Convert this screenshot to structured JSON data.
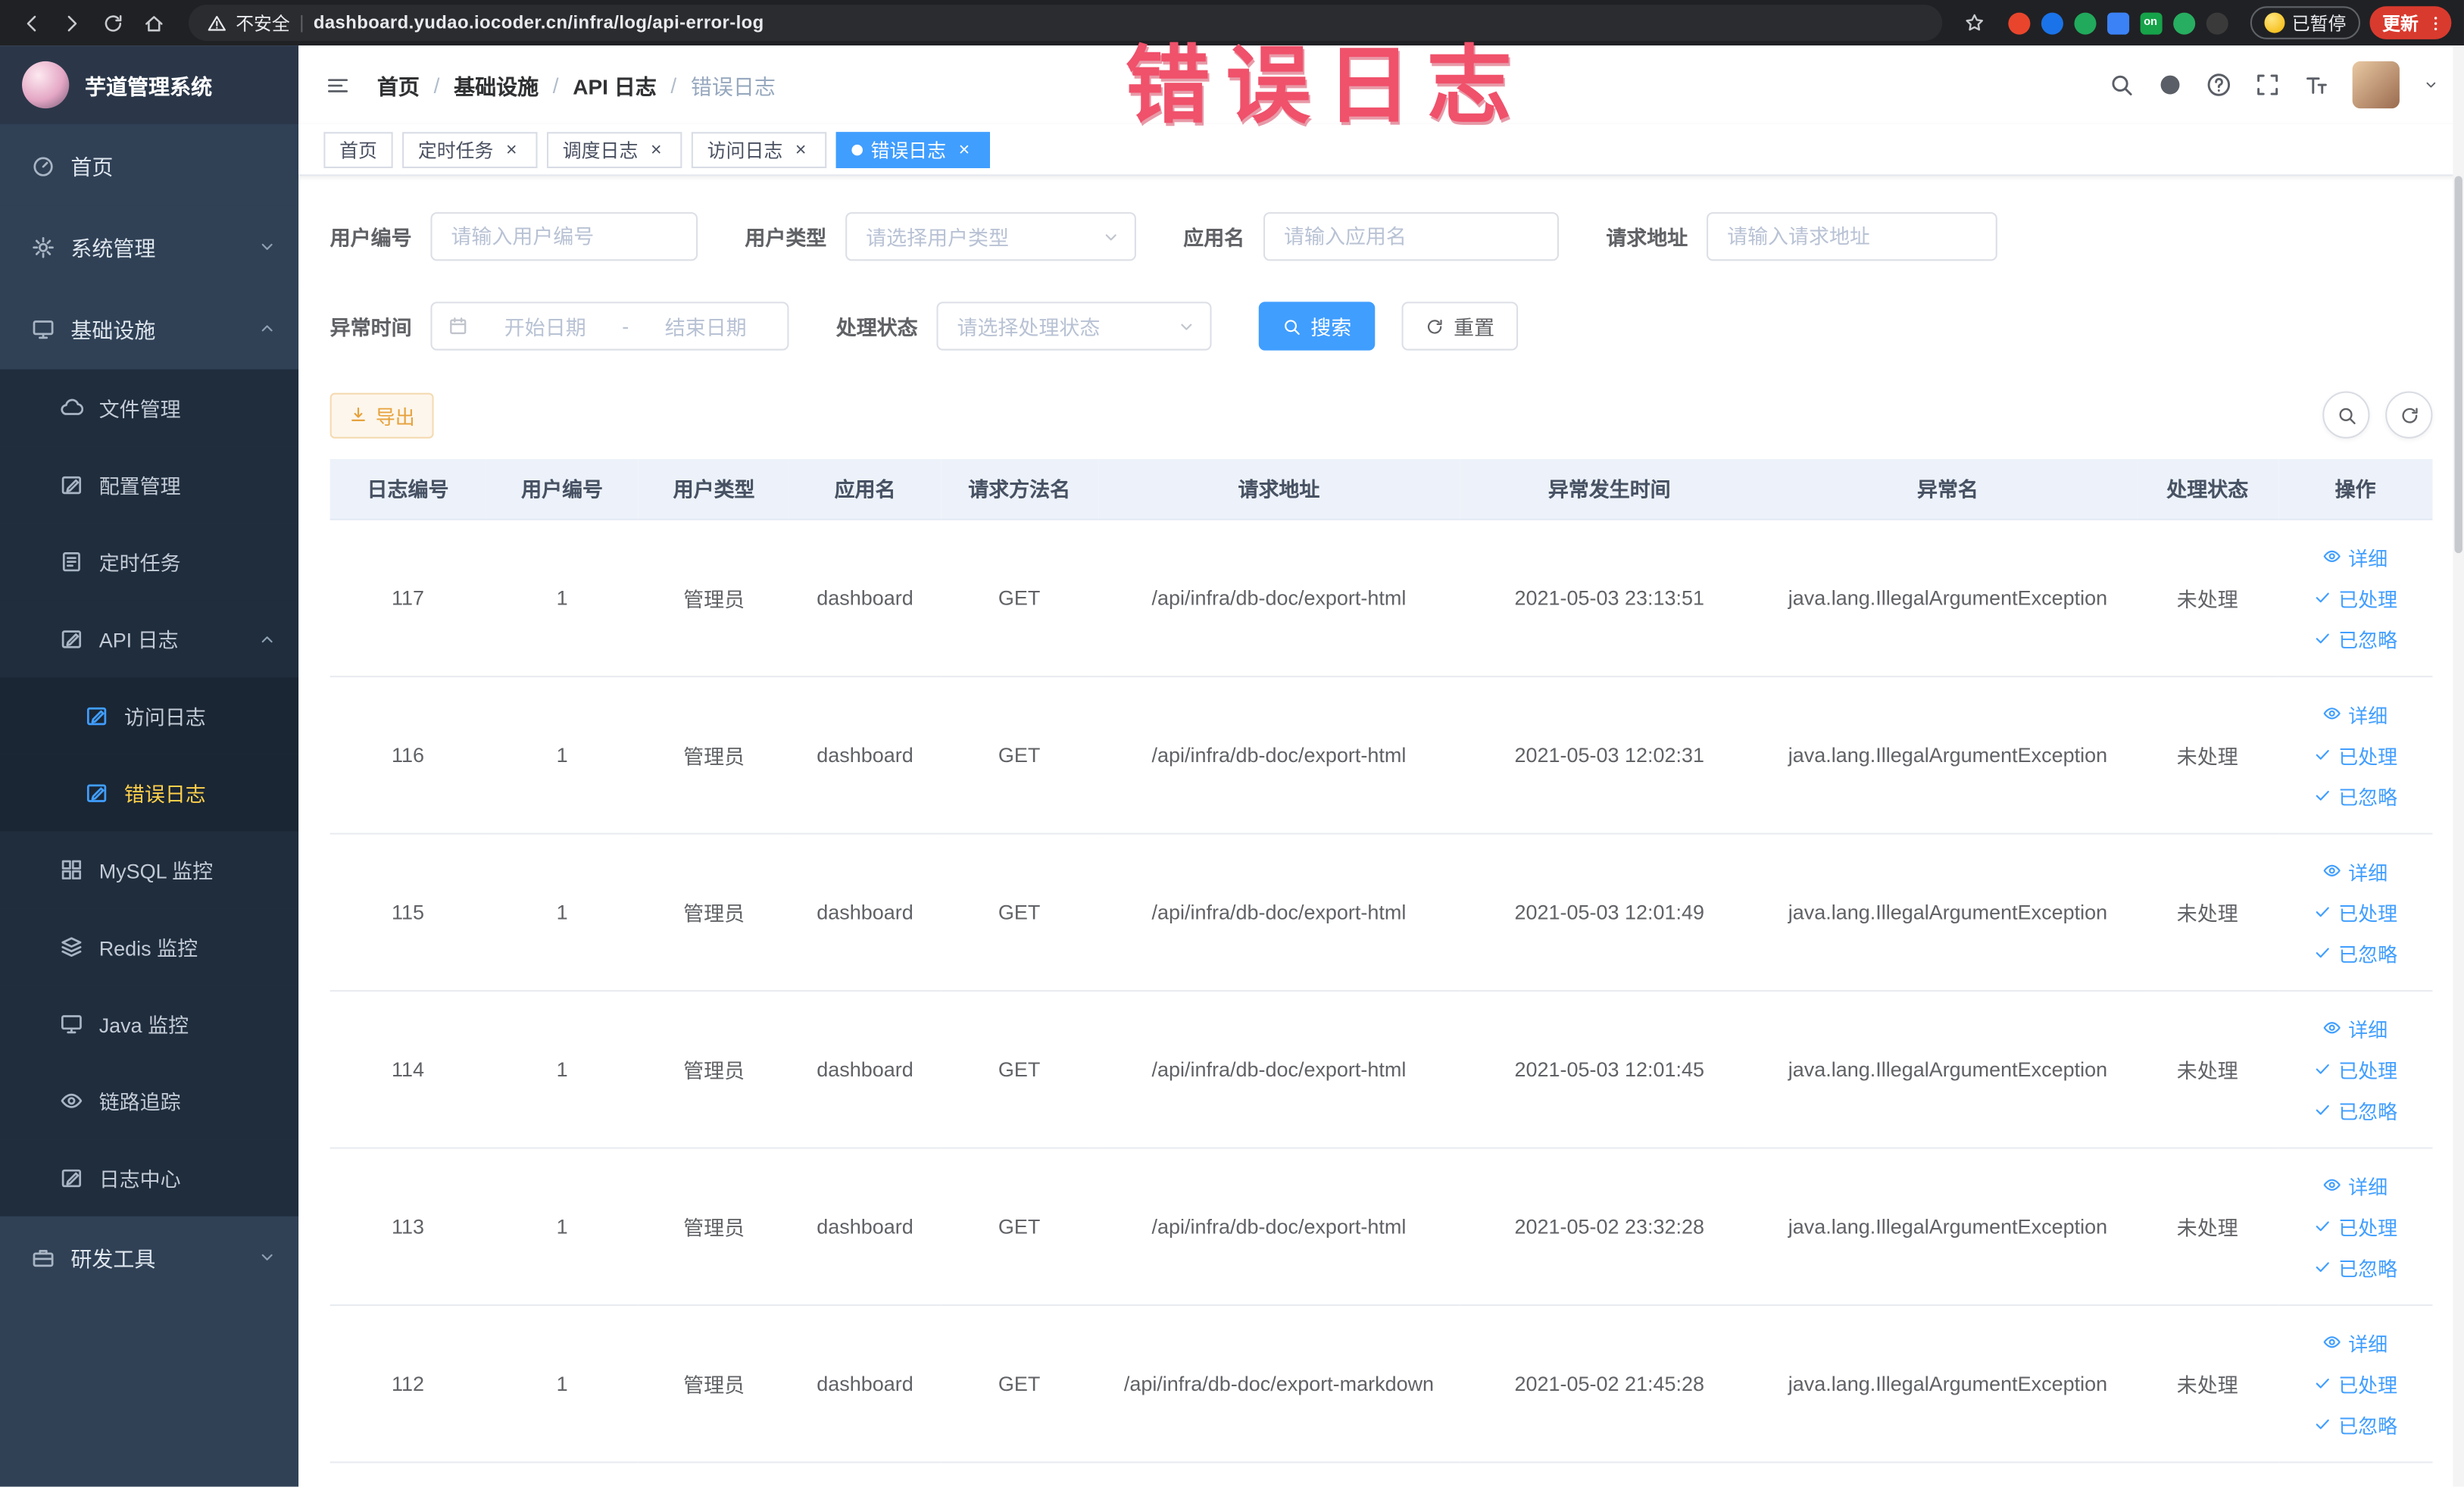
{
  "theme": {
    "primary": "#409eff",
    "warning": "#e6a23c",
    "sidebar_bg": "#304156",
    "submenu_bg": "#1f2d3d",
    "active_menu_text": "#ffd04b",
    "annotation_color": "#f0516b",
    "update_button_color": "#d93a2e"
  },
  "browser": {
    "security_label": "不安全",
    "url": "dashboard.yudao.iocoder.cn/infra/log/api-error-log",
    "paused_button": "已暂停",
    "update_button": "更新",
    "extensions": [
      {
        "name": "extension-red-circle",
        "color": "#e8452c",
        "shape": "circle",
        "text": ""
      },
      {
        "name": "extension-blue-drop",
        "color": "#1a73e8",
        "shape": "circle",
        "text": ""
      },
      {
        "name": "extension-green-circle",
        "color": "#21a95c",
        "shape": "circle",
        "text": ""
      },
      {
        "name": "extension-blue-grid",
        "color": "#3b82f6",
        "shape": "square",
        "text": ""
      },
      {
        "name": "extension-on-badge",
        "color": "#16a34a",
        "shape": "square",
        "text": "on"
      },
      {
        "name": "extension-leaf",
        "color": "#27ae60",
        "shape": "circle",
        "text": ""
      },
      {
        "name": "extension-paw",
        "color": "#3a3a3a",
        "shape": "circle",
        "text": ""
      }
    ]
  },
  "annotation": {
    "text": "错误日志"
  },
  "sidebar": {
    "logo_title": "芋道管理系统",
    "items": [
      {
        "id": "home",
        "label": "首页",
        "icon": "gauge",
        "depth": 0
      },
      {
        "id": "system",
        "label": "系统管理",
        "icon": "gear",
        "depth": 0,
        "chevron": "down"
      },
      {
        "id": "infra",
        "label": "基础设施",
        "icon": "monitor",
        "depth": 0,
        "chevron": "up"
      },
      {
        "id": "file",
        "label": "文件管理",
        "icon": "cloud",
        "depth": 1
      },
      {
        "id": "config",
        "label": "配置管理",
        "icon": "edit",
        "depth": 1
      },
      {
        "id": "job",
        "label": "定时任务",
        "icon": "list",
        "depth": 1
      },
      {
        "id": "api-log",
        "label": "API 日志",
        "icon": "edit",
        "depth": 1,
        "chevron": "up"
      },
      {
        "id": "access-log",
        "label": "访问日志",
        "icon": "edit",
        "depth": 2
      },
      {
        "id": "error-log",
        "label": "错误日志",
        "icon": "edit",
        "depth": 2,
        "active": true
      },
      {
        "id": "mysql",
        "label": "MySQL 监控",
        "icon": "grid",
        "depth": 1
      },
      {
        "id": "redis",
        "label": "Redis 监控",
        "icon": "layers",
        "depth": 1
      },
      {
        "id": "java",
        "label": "Java 监控",
        "icon": "monitor",
        "depth": 1
      },
      {
        "id": "trace",
        "label": "链路追踪",
        "icon": "eye",
        "depth": 1
      },
      {
        "id": "logcenter",
        "label": "日志中心",
        "icon": "edit",
        "depth": 1
      },
      {
        "id": "devtools",
        "label": "研发工具",
        "icon": "toolbox",
        "depth": 0,
        "chevron": "down"
      }
    ]
  },
  "breadcrumb": {
    "separator": "/",
    "items": [
      "首页",
      "基础设施",
      "API 日志",
      "错误日志"
    ]
  },
  "tabs": [
    {
      "label": "首页",
      "closable": false,
      "active": false
    },
    {
      "label": "定时任务",
      "closable": true,
      "active": false
    },
    {
      "label": "调度日志",
      "closable": true,
      "active": false
    },
    {
      "label": "访问日志",
      "closable": true,
      "active": false
    },
    {
      "label": "错误日志",
      "closable": true,
      "active": true
    }
  ],
  "filters": {
    "user_id": {
      "label": "用户编号",
      "placeholder": "请输入用户编号"
    },
    "user_type": {
      "label": "用户类型",
      "placeholder": "请选择用户类型"
    },
    "app_name": {
      "label": "应用名",
      "placeholder": "请输入应用名"
    },
    "request_url": {
      "label": "请求地址",
      "placeholder": "请输入请求地址"
    },
    "exception_time": {
      "label": "异常时间",
      "start_placeholder": "开始日期",
      "separator": "-",
      "end_placeholder": "结束日期"
    },
    "process_status": {
      "label": "处理状态",
      "placeholder": "请选择处理状态"
    },
    "search_button": "搜索",
    "reset_button": "重置"
  },
  "toolbar": {
    "export_button": "导出"
  },
  "table": {
    "columns": [
      "日志编号",
      "用户编号",
      "用户类型",
      "应用名",
      "请求方法名",
      "请求地址",
      "异常发生时间",
      "异常名",
      "处理状态",
      "操作"
    ],
    "action_labels": {
      "detail": "详细",
      "processed": "已处理",
      "ignored": "已忽略"
    },
    "rows": [
      {
        "id": "117",
        "user_id": "1",
        "user_type": "管理员",
        "app": "dashboard",
        "method": "GET",
        "url": "/api/infra/db-doc/export-html",
        "time": "2021-05-03 23:13:51",
        "exception": "java.lang.IllegalArgumentException",
        "status": "未处理"
      },
      {
        "id": "116",
        "user_id": "1",
        "user_type": "管理员",
        "app": "dashboard",
        "method": "GET",
        "url": "/api/infra/db-doc/export-html",
        "time": "2021-05-03 12:02:31",
        "exception": "java.lang.IllegalArgumentException",
        "status": "未处理"
      },
      {
        "id": "115",
        "user_id": "1",
        "user_type": "管理员",
        "app": "dashboard",
        "method": "GET",
        "url": "/api/infra/db-doc/export-html",
        "time": "2021-05-03 12:01:49",
        "exception": "java.lang.IllegalArgumentException",
        "status": "未处理"
      },
      {
        "id": "114",
        "user_id": "1",
        "user_type": "管理员",
        "app": "dashboard",
        "method": "GET",
        "url": "/api/infra/db-doc/export-html",
        "time": "2021-05-03 12:01:45",
        "exception": "java.lang.IllegalArgumentException",
        "status": "未处理"
      },
      {
        "id": "113",
        "user_id": "1",
        "user_type": "管理员",
        "app": "dashboard",
        "method": "GET",
        "url": "/api/infra/db-doc/export-html",
        "time": "2021-05-02 23:32:28",
        "exception": "java.lang.IllegalArgumentException",
        "status": "未处理"
      },
      {
        "id": "112",
        "user_id": "1",
        "user_type": "管理员",
        "app": "dashboard",
        "method": "GET",
        "url": "/api/infra/db-doc/export-markdown",
        "time": "2021-05-02 21:45:28",
        "exception": "java.lang.IllegalArgumentException",
        "status": "未处理"
      }
    ]
  }
}
